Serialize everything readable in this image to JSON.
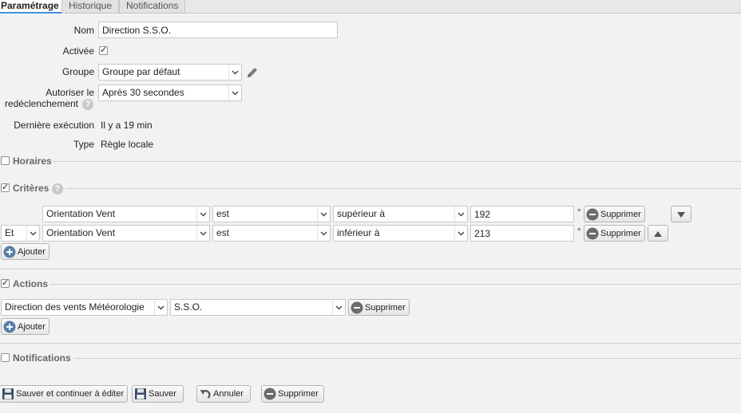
{
  "tabs": [
    {
      "label": "Paramétrage",
      "active": true
    },
    {
      "label": "Historique",
      "active": false
    },
    {
      "label": "Notifications",
      "active": false
    }
  ],
  "form": {
    "name_label": "Nom",
    "name_value": "Direction S.S.O.",
    "enabled_label": "Activée",
    "enabled": true,
    "group_label": "Groupe",
    "group_value": "Groupe par défaut",
    "retrigger_label_1": "Autoriser le",
    "retrigger_label_2": "redéclenchement",
    "retrigger_value": "Après 30 secondes",
    "last_exec_label": "Dernière exécution",
    "last_exec_value": "Il y a 19 min",
    "type_label": "Type",
    "type_value": "Règle locale"
  },
  "sections": {
    "schedules": {
      "label": "Horaires",
      "checked": false
    },
    "criteria": {
      "label": "Critères",
      "checked": true
    },
    "actions": {
      "label": "Actions",
      "checked": true
    },
    "notifications": {
      "label": "Notifications",
      "checked": false
    }
  },
  "criteria": {
    "rows": [
      {
        "connector": "",
        "field": "Orientation Vent",
        "verb": "est",
        "operator": "supérieur à",
        "value": "192",
        "unit": "°",
        "delete_label": "Supprimer",
        "move": "down"
      },
      {
        "connector": "Et",
        "field": "Orientation Vent",
        "verb": "est",
        "operator": "inférieur à",
        "value": "213",
        "unit": "°",
        "delete_label": "Supprimer",
        "move": "up"
      }
    ],
    "add_label": "Ajouter"
  },
  "actions": {
    "rows": [
      {
        "target": "Direction des vents Météorologie",
        "value": "S.S.O.",
        "delete_label": "Supprimer"
      }
    ],
    "add_label": "Ajouter"
  },
  "footer": {
    "save_continue_label": "Sauver et continuer à éditer",
    "save_label": "Sauver",
    "cancel_label": "Annuler",
    "delete_label": "Supprimer"
  },
  "colors": {
    "tab_accent": "#3f8fde",
    "remove_icon": "#6b6b6b",
    "add_icon": "#5a7fa8"
  }
}
